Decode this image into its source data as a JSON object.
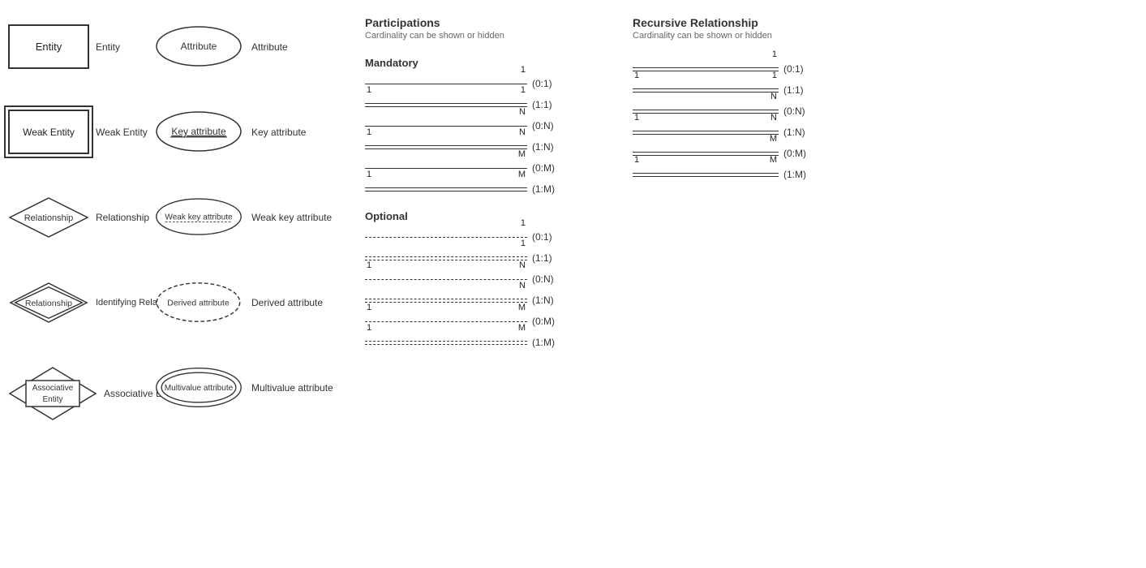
{
  "shapes": {
    "col1": [
      {
        "id": "entity",
        "label": "Entity",
        "type": "entity"
      },
      {
        "id": "weak-entity",
        "label": "Weak Entity",
        "type": "weak-entity"
      },
      {
        "id": "relationship",
        "label": "Relationship",
        "type": "diamond"
      },
      {
        "id": "identifying-relationship",
        "label": "Identifying Relationship",
        "type": "diamond-double"
      },
      {
        "id": "associative-entity",
        "label": "Associative Entity",
        "type": "assoc-entity"
      }
    ],
    "col2": [
      {
        "id": "attribute",
        "label": "Attribute",
        "type": "ellipse"
      },
      {
        "id": "key-attribute",
        "label": "Key attribute",
        "type": "ellipse-underline"
      },
      {
        "id": "weak-key-attribute",
        "label": "Weak key attribute",
        "type": "ellipse-weak-underline"
      },
      {
        "id": "derived-attribute",
        "label": "Derived attribute",
        "type": "ellipse-dashed"
      },
      {
        "id": "multivalue-attribute",
        "label": "Multivalue attribute",
        "type": "ellipse-double"
      }
    ]
  },
  "participations": {
    "title": "Participations",
    "subtitle": "Cardinality can be shown or hidden",
    "mandatory_label": "Mandatory",
    "optional_label": "Optional",
    "mandatory_rows": [
      {
        "left": "",
        "right": "1",
        "cardinality": "(0:1)"
      },
      {
        "left": "1",
        "right": "1",
        "cardinality": "(1:1)"
      },
      {
        "left": "",
        "right": "N",
        "cardinality": "(0:N)"
      },
      {
        "left": "1",
        "right": "N",
        "cardinality": "(1:N)"
      },
      {
        "left": "",
        "right": "M",
        "cardinality": "(0:M)"
      },
      {
        "left": "1",
        "right": "M",
        "cardinality": "(1:M)"
      }
    ],
    "optional_rows": [
      {
        "left": "",
        "right": "1",
        "cardinality": "(0:1)"
      },
      {
        "left": "",
        "right": "1",
        "cardinality": "(1:1)"
      },
      {
        "left": "1",
        "right": "N",
        "cardinality": "(0:N)"
      },
      {
        "left": "",
        "right": "N",
        "cardinality": "(1:N)"
      },
      {
        "left": "1",
        "right": "M",
        "cardinality": "(0:M)"
      },
      {
        "left": "1",
        "right": "M",
        "cardinality": "(1:M)"
      }
    ]
  },
  "recursive": {
    "title": "Recursive Relationship",
    "subtitle": "Cardinality can be shown or hidden",
    "rows": [
      {
        "left": "",
        "right": "1",
        "cardinality": "(0:1)"
      },
      {
        "left": "1",
        "right": "1",
        "cardinality": "(1:1)"
      },
      {
        "left": "",
        "right": "N",
        "cardinality": "(0:N)"
      },
      {
        "left": "1",
        "right": "N",
        "cardinality": "(1:N)"
      },
      {
        "left": "",
        "right": "M",
        "cardinality": "(0:M)"
      },
      {
        "left": "1",
        "right": "M",
        "cardinality": "(1:M)"
      }
    ]
  }
}
